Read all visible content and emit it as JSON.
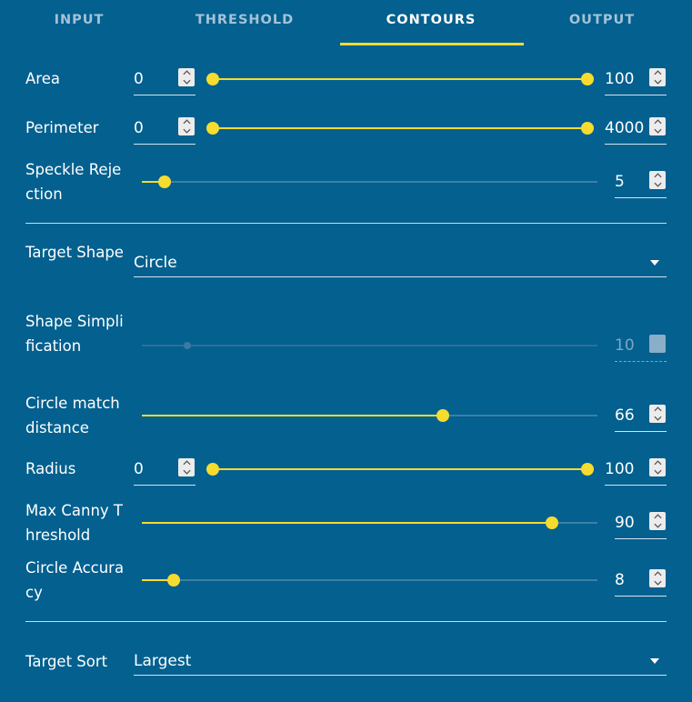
{
  "tabs": [
    {
      "label": "INPUT",
      "active": false
    },
    {
      "label": "THRESHOLD",
      "active": false
    },
    {
      "label": "CONTOURS",
      "active": true
    },
    {
      "label": "OUTPUT",
      "active": false
    }
  ],
  "controls": {
    "area": {
      "label": "Area",
      "min_value": "0",
      "max_value": "100",
      "range_low_fraction": 0.0,
      "range_high_fraction": 1.0
    },
    "perimeter": {
      "label": "Perimeter",
      "min_value": "0",
      "max_value": "4000",
      "range_low_fraction": 0.0,
      "range_high_fraction": 1.0
    },
    "speckle_rejection": {
      "label": "Speckle Rejection",
      "value": "5",
      "level_fraction": 0.05
    },
    "target_shape": {
      "label": "Target Shape",
      "selected": "Circle"
    },
    "shape_simplification": {
      "label": "Shape Simplification",
      "value": "10",
      "level_fraction": 0.1,
      "disabled": true
    },
    "circle_match_distance": {
      "label": "Circle match distance",
      "value": "66",
      "level_fraction": 0.66
    },
    "radius": {
      "label": "Radius",
      "min_value": "0",
      "max_value": "100",
      "range_low_fraction": 0.0,
      "range_high_fraction": 1.0
    },
    "max_canny_threshold": {
      "label": "Max Canny Threshold",
      "value": "90",
      "level_fraction": 0.9
    },
    "circle_accuracy": {
      "label": "Circle Accuracy",
      "value": "8",
      "level_fraction": 0.07
    },
    "target_sort": {
      "label": "Target Sort",
      "selected": "Largest"
    }
  },
  "colors": {
    "background": "#03608f",
    "accent": "#f6dc2e",
    "track": "#3e7fa6",
    "tab_inactive": "#a4c3d8"
  }
}
